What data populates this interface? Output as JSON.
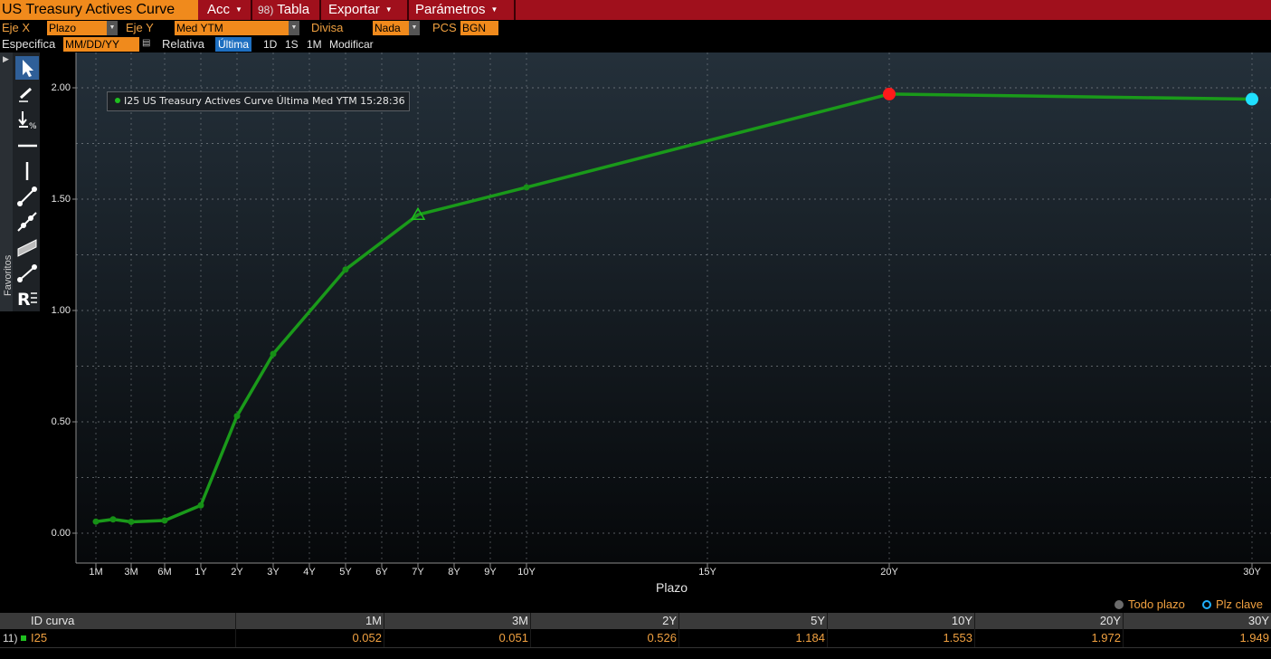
{
  "menu": {
    "title": "US Treasury Actives Curve",
    "acc": "Acc",
    "tabla_icon": "98)",
    "tabla": "Tabla",
    "exportar": "Exportar",
    "parametros": "Parámetros"
  },
  "controls": {
    "eje_x_label": "Eje X",
    "eje_x_value": "Plazo",
    "eje_y_label": "Eje Y",
    "eje_y_value": "Med YTM",
    "divisa_label": "Divisa",
    "divisa_value": "Nada",
    "pcs_label": "PCS",
    "pcs_value": "BGN",
    "especifica_label": "Especifica",
    "date_placeholder": "MM/DD/YY",
    "relativa_label": "Relativa",
    "ultima": "Última",
    "d1": "1D",
    "s1": "1S",
    "m1": "1M",
    "modificar": "Modificar"
  },
  "toolbar": {
    "favoritos": "Favoritos",
    "tools": [
      "cursor-arrow-icon",
      "pencil-icon",
      "measure-percent-icon",
      "horizontal-line-icon",
      "vertical-line-icon",
      "trend-line-icon",
      "ray-line-icon",
      "channel-icon",
      "segment-line-icon",
      "text-annotation-icon"
    ],
    "text_tool_label": "R"
  },
  "legend": {
    "text": "I25 US Treasury Actives Curve Última Med YTM 15:28:36",
    "color": "#1fbf1f"
  },
  "chart_data": {
    "type": "line",
    "xlabel": "Plazo",
    "ylabel": "",
    "ylim": [
      -0.14,
      2.22
    ],
    "yticks": [
      "0.00",
      "0.50",
      "1.00",
      "1.50",
      "2.00"
    ],
    "x_tick_labels": [
      "1M",
      "3M",
      "6M",
      "1Y",
      "2Y",
      "3Y",
      "4Y",
      "5Y",
      "6Y",
      "7Y",
      "8Y",
      "9Y",
      "10Y",
      "15Y",
      "20Y",
      "30Y"
    ],
    "grid": true,
    "series": [
      {
        "name": "I25",
        "color": "#1a9a1a",
        "points": [
          {
            "x": "1M",
            "y": 0.052
          },
          {
            "x": "2M",
            "y": 0.062
          },
          {
            "x": "3M",
            "y": 0.051
          },
          {
            "x": "6M",
            "y": 0.057
          },
          {
            "x": "1Y",
            "y": 0.125
          },
          {
            "x": "2Y",
            "y": 0.526
          },
          {
            "x": "3Y",
            "y": 0.805
          },
          {
            "x": "5Y",
            "y": 1.184
          },
          {
            "x": "7Y",
            "y": 1.43
          },
          {
            "x": "10Y",
            "y": 1.553
          },
          {
            "x": "20Y",
            "y": 1.972
          },
          {
            "x": "30Y",
            "y": 1.949
          }
        ]
      }
    ],
    "markers": {
      "triangle_at": "7Y",
      "red_dot_at": "20Y",
      "cyan_dot_at": "30Y",
      "red": "#ff1a1a",
      "cyan": "#20e0ff"
    }
  },
  "keys": {
    "todo_plazo": "Todo plazo",
    "plz_clave": "Plz clave",
    "todo_color": "#6b6b6b",
    "plz_color": "#20b0ff"
  },
  "table": {
    "header": {
      "id_curva": "ID curva",
      "cols": [
        "1M",
        "3M",
        "2Y",
        "5Y",
        "10Y",
        "20Y",
        "30Y"
      ]
    },
    "row": {
      "index": "11)",
      "id": "I25",
      "values": [
        "0.052",
        "0.051",
        "0.526",
        "1.184",
        "1.553",
        "1.972",
        "1.949"
      ]
    }
  }
}
